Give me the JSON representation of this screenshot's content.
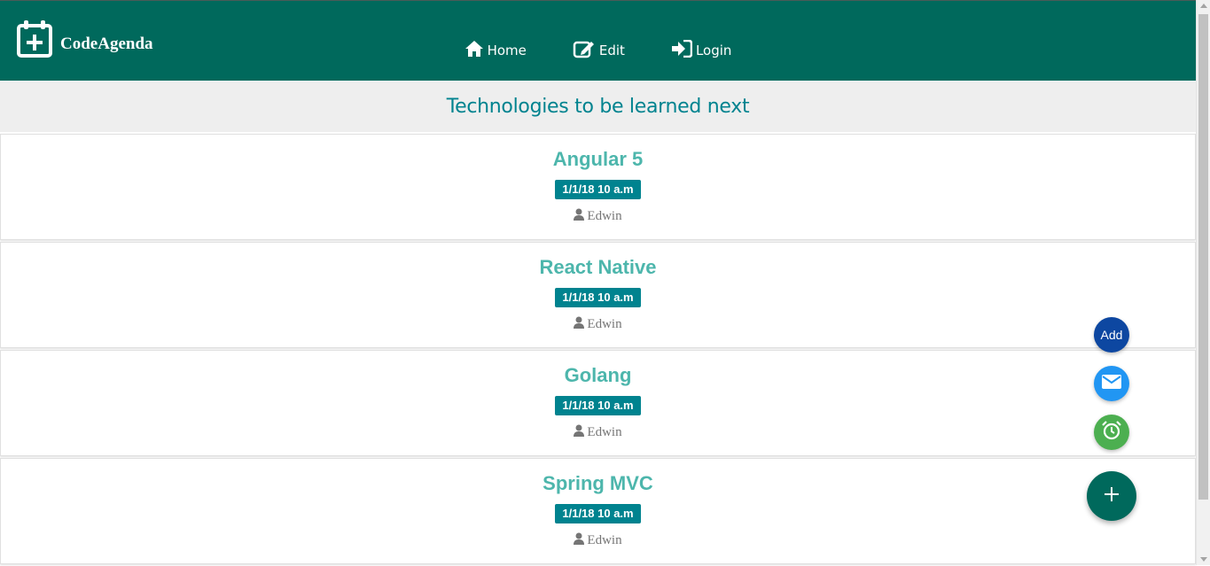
{
  "brand": {
    "name": "CodeAgenda"
  },
  "nav": {
    "items": [
      {
        "label": "Home"
      },
      {
        "label": "Edit"
      },
      {
        "label": "Login"
      }
    ]
  },
  "subheader": {
    "title": "Technologies to be learned next"
  },
  "events": [
    {
      "title": "Angular 5",
      "date": "1/1/18 10 a.m",
      "author": "Edwin"
    },
    {
      "title": "React Native",
      "date": "1/1/18 10 a.m",
      "author": "Edwin"
    },
    {
      "title": "Golang",
      "date": "1/1/18 10 a.m",
      "author": "Edwin"
    },
    {
      "title": "Spring MVC",
      "date": "1/1/18 10 a.m",
      "author": "Edwin"
    }
  ],
  "fab": {
    "add_label": "Add"
  },
  "colors": {
    "primary": "#00695c",
    "accent": "#00838f",
    "title": "#4db6ac",
    "add": "#0d47a1",
    "mail": "#2196f3",
    "alarm": "#4caf50"
  }
}
